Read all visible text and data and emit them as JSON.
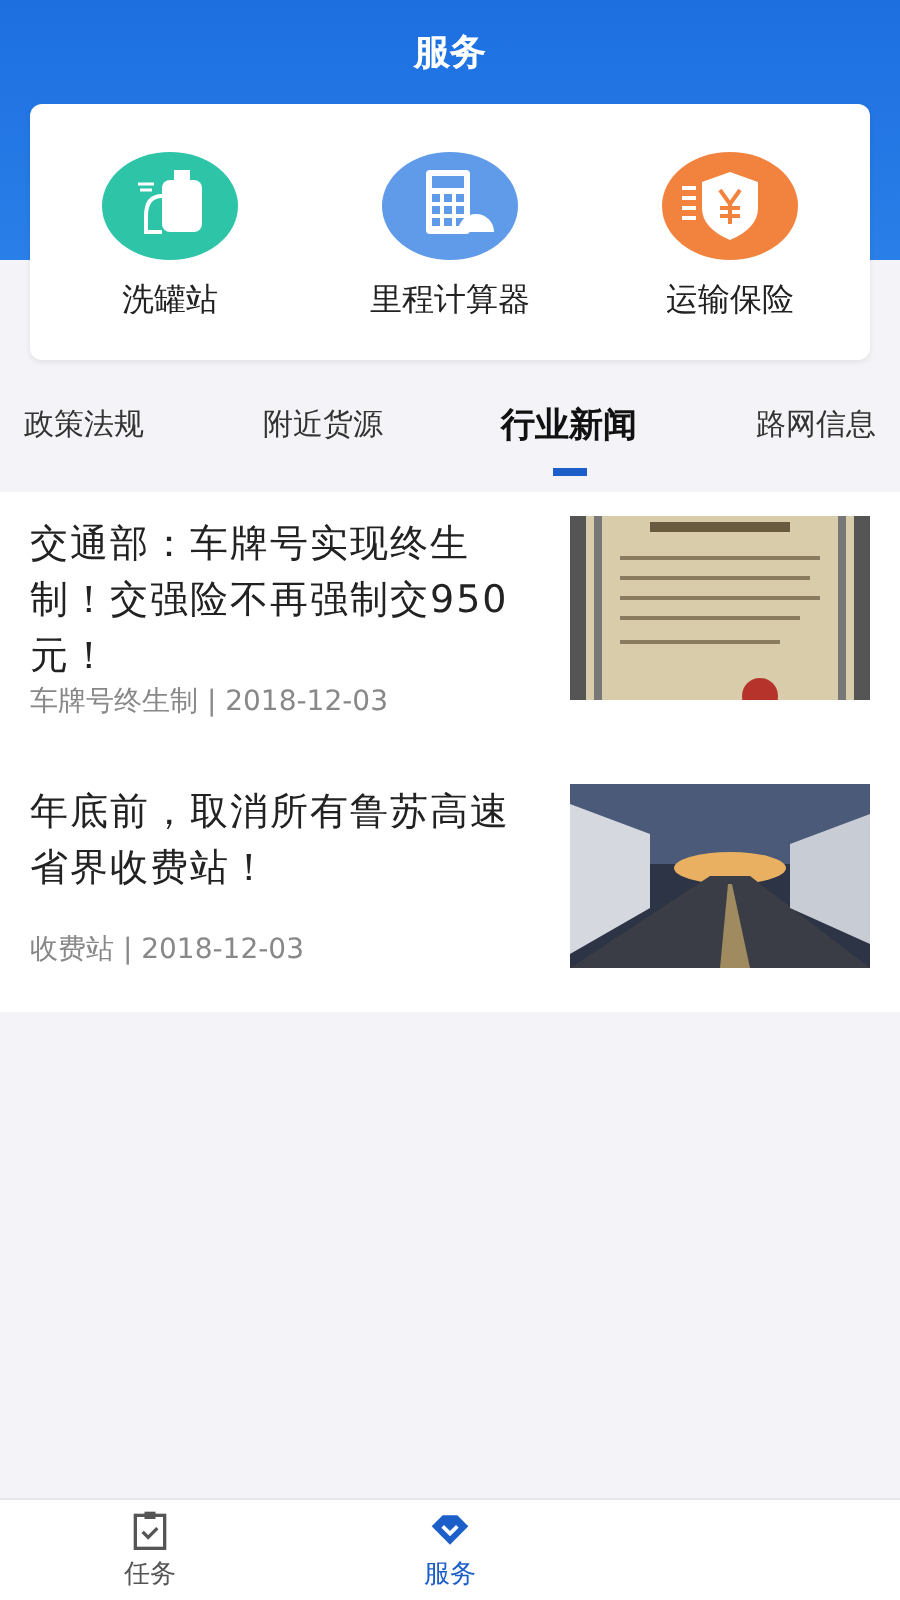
{
  "header": {
    "title": "服务"
  },
  "services": [
    {
      "label": "洗罐站",
      "kind": "wash",
      "color": "#2ec4a8"
    },
    {
      "label": "里程计算器",
      "kind": "calculator",
      "color": "#5f9be8"
    },
    {
      "label": "运输保险",
      "kind": "insurance",
      "color": "#f2833f"
    }
  ],
  "tabs": [
    {
      "label": "政策法规",
      "selected": false
    },
    {
      "label": "附近货源",
      "selected": false
    },
    {
      "label": "行业新闻",
      "selected": true
    },
    {
      "label": "路网信息",
      "selected": false
    }
  ],
  "news": [
    {
      "title": "交通部：车牌号实现终生制！交强险不再强制交950元！",
      "meta": "车牌号终生制 | 2018-12-03"
    },
    {
      "title": "年底前，取消所有鲁苏高速省界收费站！",
      "meta": "收费站 | 2018-12-03"
    }
  ],
  "nav": [
    {
      "label": "任务",
      "kind": "task",
      "selected": false
    },
    {
      "label": "服务",
      "kind": "service",
      "selected": true
    }
  ]
}
